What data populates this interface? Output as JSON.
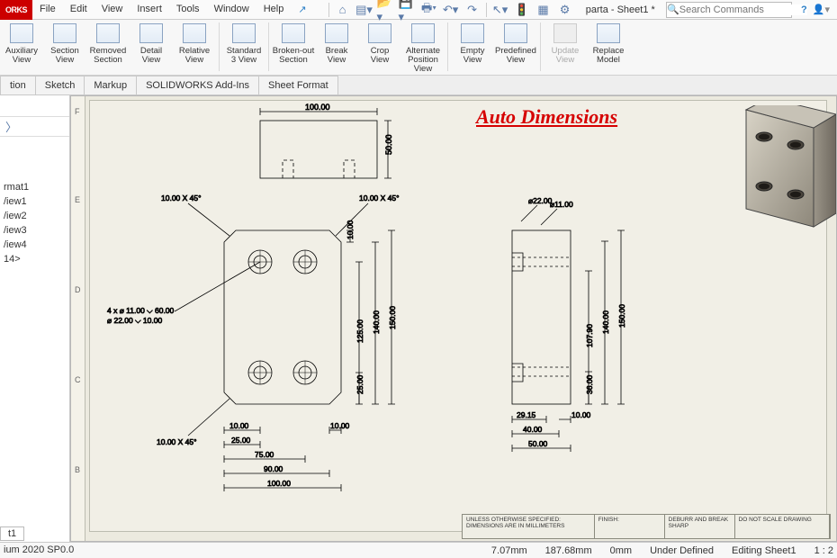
{
  "app": {
    "logo": "ORKS"
  },
  "menu": [
    "File",
    "Edit",
    "View",
    "Insert",
    "Tools",
    "Window",
    "Help"
  ],
  "quick_icons": [
    "cursor",
    "home",
    "new",
    "open",
    "save",
    "print",
    "options",
    "undo",
    "redo",
    "select",
    "stoplight",
    "settings",
    "rebuild"
  ],
  "doc_title": "parta - Sheet1 *",
  "search": {
    "placeholder": "Search Commands"
  },
  "ribbon": [
    {
      "label": "Auxiliary\nView",
      "dis": false
    },
    {
      "label": "Section\nView",
      "dis": false
    },
    {
      "label": "Removed\nSection",
      "dis": false
    },
    {
      "label": "Detail\nView",
      "dis": false
    },
    {
      "label": "Relative\nView",
      "dis": false
    },
    {
      "sep": true
    },
    {
      "label": "Standard\n3 View",
      "dis": false
    },
    {
      "sep": true
    },
    {
      "label": "Broken-out\nSection",
      "dis": false
    },
    {
      "label": "Break\nView",
      "dis": false
    },
    {
      "label": "Crop\nView",
      "dis": false
    },
    {
      "label": "Alternate\nPosition\nView",
      "dis": false
    },
    {
      "sep": true
    },
    {
      "label": "Empty\nView",
      "dis": false
    },
    {
      "label": "Predefined\nView",
      "dis": false
    },
    {
      "sep": true
    },
    {
      "label": "Update\nView",
      "dis": true
    },
    {
      "label": "Replace\nModel",
      "dis": false
    }
  ],
  "tabs": [
    "tion",
    "Sketch",
    "Markup",
    "SOLIDWORKS Add-Ins",
    "Sheet Format"
  ],
  "tree": {
    "items": [
      "rmat1",
      "/iew1",
      "/iew2",
      "/iew3",
      "/iew4",
      "14>"
    ]
  },
  "sheet_tab": "t1",
  "version": "ium 2020 SP0.0",
  "status": {
    "x": "7.07mm",
    "y": "187.68mm",
    "z": "0mm",
    "state": "Under Defined",
    "mode": "Editing Sheet1",
    "scale": "1 : 2"
  },
  "annotation_title": "Auto Dimensions",
  "ruler_letters": [
    "F",
    "E",
    "D",
    "C",
    "B"
  ],
  "dims": {
    "top_view": {
      "w": "100.00",
      "h": "50.00"
    },
    "front": {
      "chamfer_tl": "10.00 X 45°",
      "chamfer_tr": "10.00 X 45°",
      "chamfer_bl": "10.00 X 45°",
      "hole_call": "4 x ⌀ 11.00 ⌵ 60.00",
      "hole_call2": "⌀ 22.00 ⌵ 10.00",
      "h1": "125.00",
      "h2": "140.00",
      "h3": "150.00",
      "bot25": "25.00",
      "left10a": "10.00",
      "left25": "25.00",
      "right_top10": "10.00",
      "b75": "75.00",
      "b90": "90.00",
      "b100": "100.00",
      "b10": "10.00"
    },
    "side": {
      "phi22": "⌀22.00",
      "phi11": "⌀11.00",
      "h10790": "107.90",
      "h140": "140.00",
      "h150": "150.00",
      "h36": "36.00",
      "w2915": "29.15",
      "w40": "40.00",
      "w50": "50.00",
      "w10": "10.00"
    },
    "titleblock": {
      "c1": "UNLESS OTHERWISE SPECIFIED:\nDIMENSIONS ARE IN MILLIMETERS",
      "c2": "FINISH:",
      "c3": "DEBURR AND\nBREAK SHARP",
      "c4": "DO NOT SCALE DRAWING"
    }
  }
}
